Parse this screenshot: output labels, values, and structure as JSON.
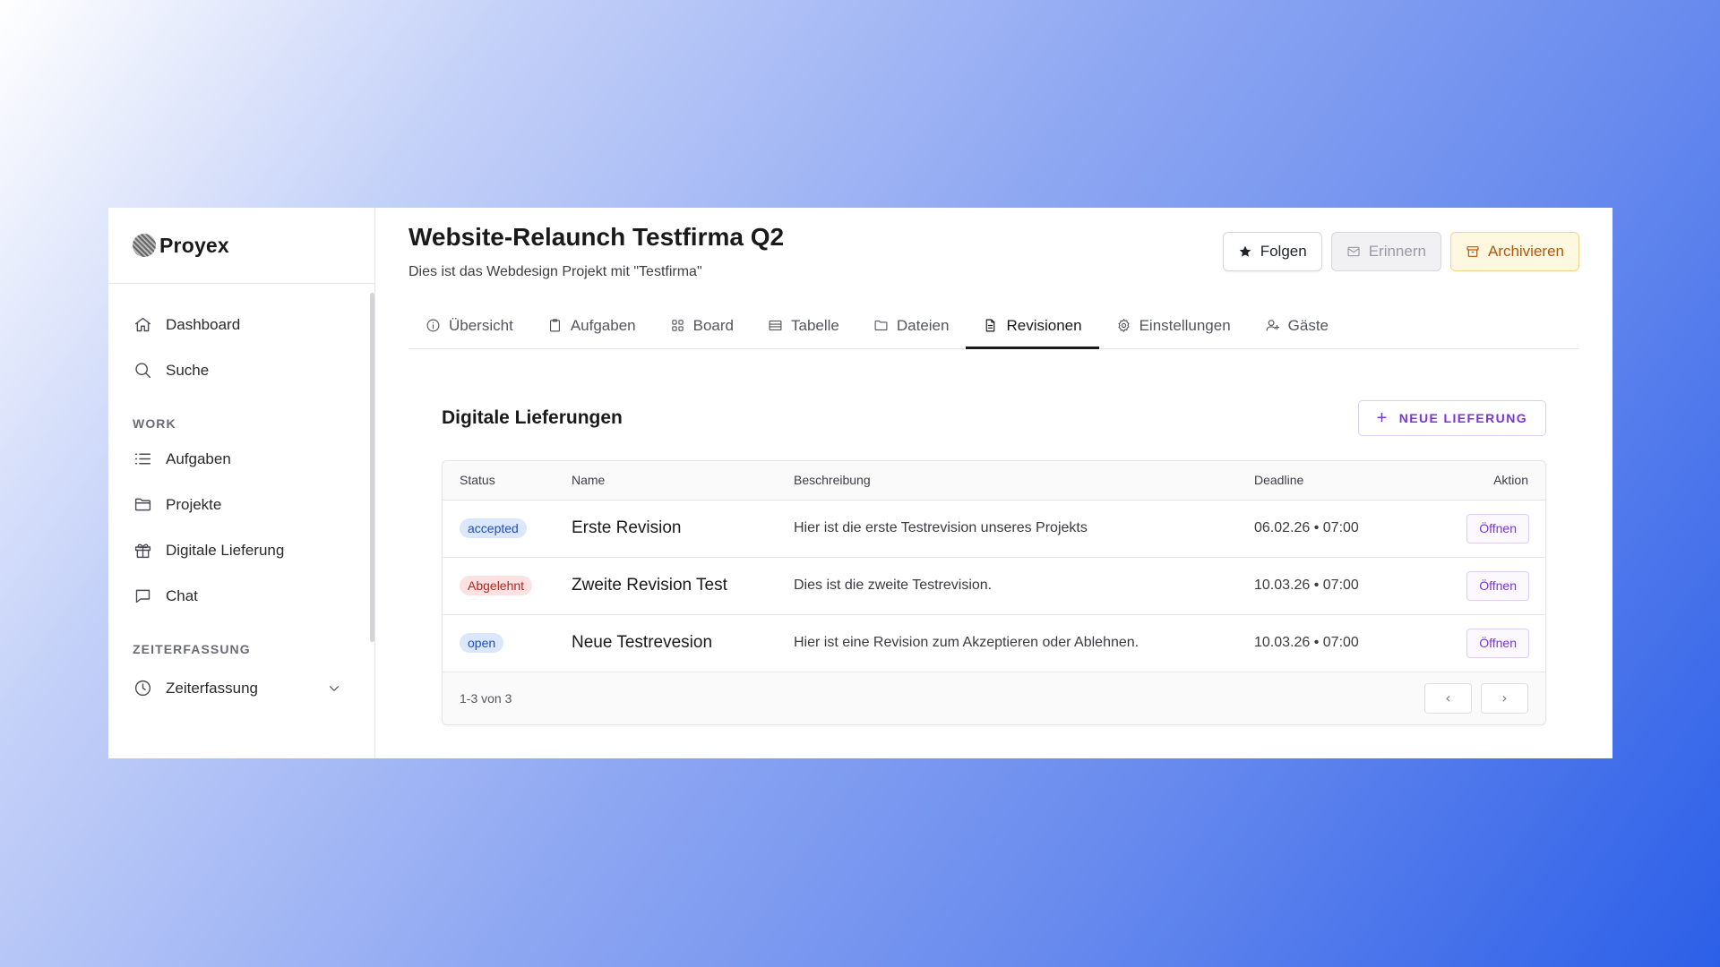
{
  "brand": {
    "name": "Proyex"
  },
  "sidebar": {
    "items_top": [
      {
        "label": "Dashboard",
        "icon": "home-icon"
      },
      {
        "label": "Suche",
        "icon": "search-icon"
      }
    ],
    "section_work": "WORK",
    "items_work": [
      {
        "label": "Aufgaben",
        "icon": "list-icon"
      },
      {
        "label": "Projekte",
        "icon": "folder-icon"
      },
      {
        "label": "Digitale Lieferung",
        "icon": "gift-icon"
      },
      {
        "label": "Chat",
        "icon": "chat-icon"
      }
    ],
    "section_time": "ZEITERFASSUNG",
    "item_time": {
      "label": "Zeiterfassung",
      "icon": "clock-icon"
    }
  },
  "header": {
    "title": "Website-Relaunch Testfirma Q2",
    "subtitle": "Dies ist das Webdesign Projekt mit \"Testfirma\"",
    "follow_label": "Folgen",
    "remind_label": "Erinnern",
    "archive_label": "Archivieren"
  },
  "tabs": [
    {
      "label": "Übersicht",
      "icon": "info-icon"
    },
    {
      "label": "Aufgaben",
      "icon": "clipboard-icon"
    },
    {
      "label": "Board",
      "icon": "grid-icon"
    },
    {
      "label": "Tabelle",
      "icon": "table-icon"
    },
    {
      "label": "Dateien",
      "icon": "folder-icon"
    },
    {
      "label": "Revisionen",
      "icon": "document-icon",
      "active": true
    },
    {
      "label": "Einstellungen",
      "icon": "gear-icon"
    },
    {
      "label": "Gäste",
      "icon": "user-plus-icon"
    }
  ],
  "section": {
    "title": "Digitale Lieferungen",
    "new_button": "NEUE LIEFERUNG"
  },
  "table": {
    "columns": [
      "Status",
      "Name",
      "Beschreibung",
      "Deadline",
      "Aktion"
    ],
    "rows": [
      {
        "status": "accepted",
        "name": "Erste Revision",
        "description": "Hier ist die erste Testrevision unseres Projekts",
        "deadline": "06.02.26 • 07:00",
        "action": "Öffnen"
      },
      {
        "status": "Abgelehnt",
        "name": "Zweite Revision Test",
        "description": "Dies ist die zweite Testrevision.",
        "deadline": "10.03.26 • 07:00",
        "action": "Öffnen"
      },
      {
        "status": "open",
        "name": "Neue Testrevesion",
        "description": "Hier ist eine Revision zum Akzeptieren oder Ablehnen.",
        "deadline": "10.03.26 • 07:00",
        "action": "Öffnen"
      }
    ],
    "footer_count": "1-3 von 3",
    "prev_symbol": "‹",
    "next_symbol": "›"
  },
  "colors": {
    "accent_purple": "#7a35d6",
    "archive_orange": "#b4560e",
    "badge_blue": "#1f4fb8",
    "badge_red": "#b3261e"
  }
}
